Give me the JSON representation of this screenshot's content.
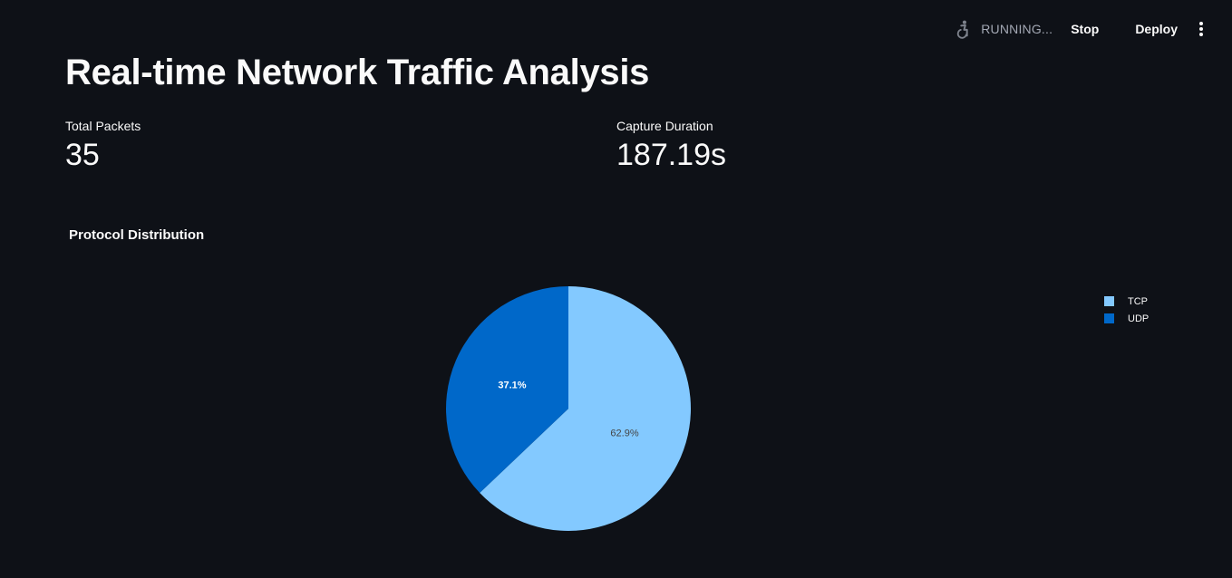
{
  "header": {
    "status_text": "RUNNING...",
    "stop_label": "Stop",
    "deploy_label": "Deploy",
    "status_icon": "running-person-icon",
    "menu_icon": "kebab-menu-icon"
  },
  "page": {
    "title": "Real-time Network Traffic Analysis"
  },
  "metrics": [
    {
      "label": "Total Packets",
      "value": "35"
    },
    {
      "label": "Capture Duration",
      "value": "187.19s"
    }
  ],
  "chart": {
    "title": "Protocol Distribution"
  },
  "chart_data": {
    "type": "pie",
    "title": "Protocol Distribution",
    "slices": [
      {
        "label": "TCP",
        "value": 62.9,
        "display": "62.9%",
        "color": "#83c9ff",
        "text_color": "#444444"
      },
      {
        "label": "UDP",
        "value": 37.1,
        "display": "37.1%",
        "color": "#0068c9",
        "text_color": "#ffffff"
      }
    ],
    "start": "12 o'clock",
    "direction": "clockwise",
    "legend_position": "top-right"
  },
  "colors": {
    "background": "#0e1117",
    "text": "#fafafa",
    "muted": "#a3a8b4"
  }
}
